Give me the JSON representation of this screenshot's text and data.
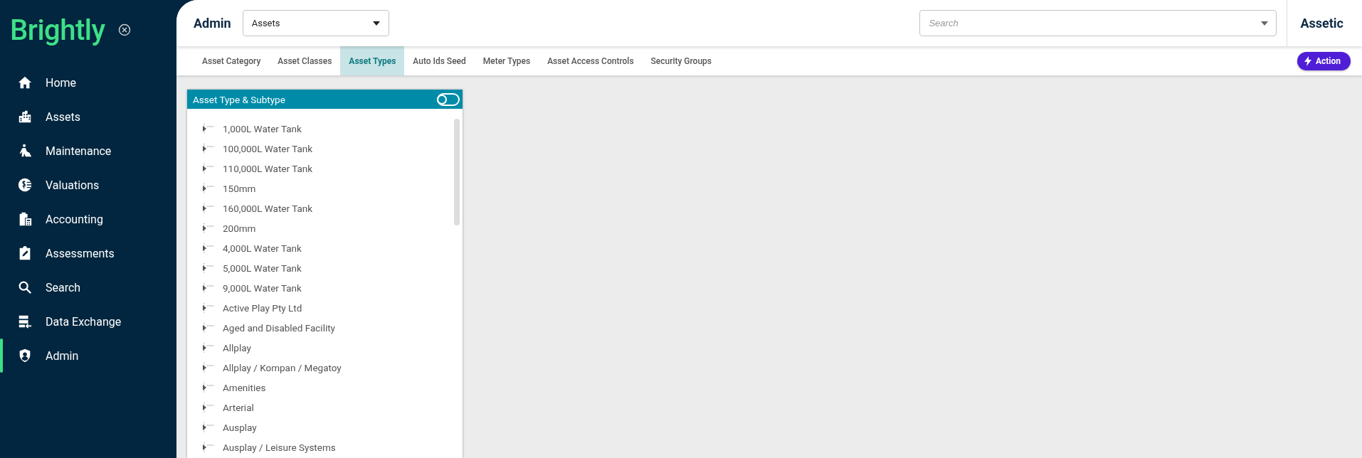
{
  "sidebar": {
    "logo": "Brightly",
    "items": [
      {
        "label": "Home",
        "selected": false
      },
      {
        "label": "Assets",
        "selected": false
      },
      {
        "label": "Maintenance",
        "selected": false
      },
      {
        "label": "Valuations",
        "selected": false
      },
      {
        "label": "Accounting",
        "selected": false
      },
      {
        "label": "Assessments",
        "selected": false
      },
      {
        "label": "Search",
        "selected": false
      },
      {
        "label": "Data Exchange",
        "selected": false
      },
      {
        "label": "Admin",
        "selected": true
      }
    ]
  },
  "header": {
    "title": "Admin",
    "module_select": {
      "value": "Assets"
    },
    "search": {
      "placeholder": "Search"
    },
    "tenant": "Assetic"
  },
  "tabs": [
    {
      "label": "Asset Category",
      "selected": false
    },
    {
      "label": "Asset Classes",
      "selected": false
    },
    {
      "label": "Asset Types",
      "selected": true
    },
    {
      "label": "Auto Ids Seed",
      "selected": false
    },
    {
      "label": "Meter Types",
      "selected": false
    },
    {
      "label": "Asset Access Controls",
      "selected": false
    },
    {
      "label": "Security Groups",
      "selected": false
    }
  ],
  "action_button": "Action",
  "panel": {
    "title": "Asset Type & Subtype",
    "toggle": {
      "on": false
    },
    "tree": [
      {
        "label": "1,000L Water Tank",
        "expanded": false
      },
      {
        "label": "100,000L Water Tank",
        "expanded": false
      },
      {
        "label": "110,000L Water Tank",
        "expanded": false
      },
      {
        "label": "150mm",
        "expanded": false
      },
      {
        "label": "160,000L Water Tank",
        "expanded": false
      },
      {
        "label": "200mm",
        "expanded": false
      },
      {
        "label": "4,000L Water Tank",
        "expanded": false
      },
      {
        "label": "5,000L Water Tank",
        "expanded": false
      },
      {
        "label": "9,000L Water Tank",
        "expanded": false
      },
      {
        "label": "Active Play Pty Ltd",
        "expanded": false
      },
      {
        "label": "Aged and Disabled Facility",
        "expanded": false
      },
      {
        "label": "Allplay",
        "expanded": false
      },
      {
        "label": "Allplay / Kompan / Megatoy",
        "expanded": false
      },
      {
        "label": "Amenities",
        "expanded": false
      },
      {
        "label": "Arterial",
        "expanded": false
      },
      {
        "label": "Ausplay",
        "expanded": false
      },
      {
        "label": "Ausplay / Leisure Systems",
        "expanded": false
      }
    ]
  }
}
